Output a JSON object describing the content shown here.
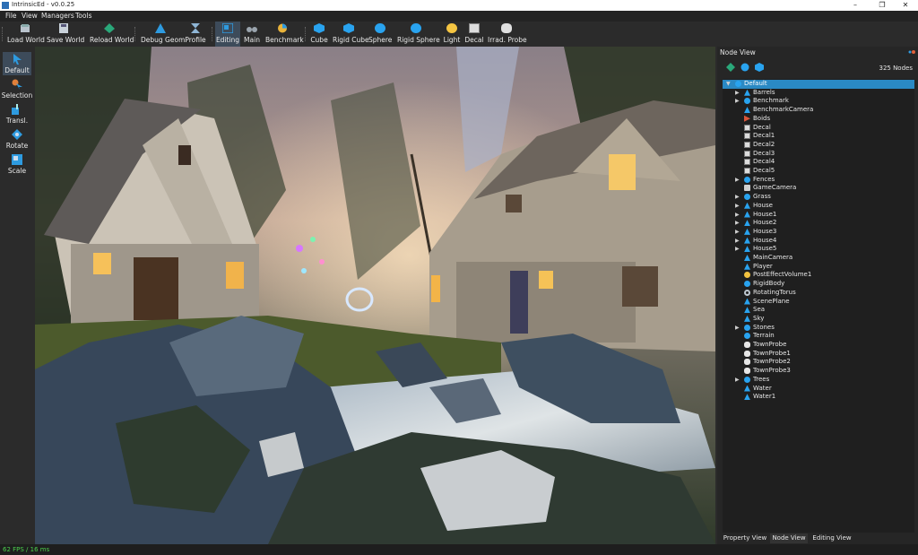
{
  "window": {
    "title": "IntrinsicEd - v0.0.25",
    "minimize": "–",
    "maximize": "❐",
    "close": "✕"
  },
  "menu": [
    "File",
    "View",
    "Managers",
    "Tools"
  ],
  "toolbar": {
    "load_world": "Load World",
    "save_world": "Save World",
    "reload_world": "Reload World",
    "debug_geom": "Debug Geom.",
    "profile": "Profile",
    "editing": "Editing",
    "main": "Main",
    "benchmark": "Benchmark",
    "cube": "Cube",
    "rigid_cube": "Rigid Cube",
    "sphere": "Sphere",
    "rigid_sphere": "Rigid Sphere",
    "light": "Light",
    "decal": "Decal",
    "irrad_probe": "Irrad. Probe"
  },
  "left_tools": {
    "default": "Default",
    "selection": "Selection",
    "translate": "Transl.",
    "rotate": "Rotate",
    "scale": "Scale"
  },
  "panel": {
    "title": "Node View",
    "node_count": "325 Nodes"
  },
  "tree": [
    {
      "label": "Default",
      "icon": "sphere-icon",
      "level": 0,
      "arrow": "▼",
      "selected": true
    },
    {
      "label": "Barrels",
      "icon": "drop-icon",
      "level": 1,
      "arrow": "▶"
    },
    {
      "label": "Benchmark",
      "icon": "sphere-icon",
      "level": 1,
      "arrow": "▶"
    },
    {
      "label": "BenchmarkCamera",
      "icon": "drop-icon",
      "level": 1,
      "arrow": ""
    },
    {
      "label": "Boids",
      "icon": "boids-icon",
      "level": 1,
      "arrow": ""
    },
    {
      "label": "Decal",
      "icon": "image-icon",
      "level": 1,
      "arrow": ""
    },
    {
      "label": "Decal1",
      "icon": "image-icon",
      "level": 1,
      "arrow": ""
    },
    {
      "label": "Decal2",
      "icon": "image-icon",
      "level": 1,
      "arrow": ""
    },
    {
      "label": "Decal3",
      "icon": "image-icon",
      "level": 1,
      "arrow": ""
    },
    {
      "label": "Decal4",
      "icon": "image-icon",
      "level": 1,
      "arrow": ""
    },
    {
      "label": "Decal5",
      "icon": "image-icon",
      "level": 1,
      "arrow": ""
    },
    {
      "label": "Fences",
      "icon": "sphere-icon",
      "level": 1,
      "arrow": "▶"
    },
    {
      "label": "GameCamera",
      "icon": "camera-icon",
      "level": 1,
      "arrow": ""
    },
    {
      "label": "Grass",
      "icon": "sphere-icon",
      "level": 1,
      "arrow": "▶"
    },
    {
      "label": "House",
      "icon": "drop-icon",
      "level": 1,
      "arrow": "▶"
    },
    {
      "label": "House1",
      "icon": "drop-icon",
      "level": 1,
      "arrow": "▶"
    },
    {
      "label": "House2",
      "icon": "drop-icon",
      "level": 1,
      "arrow": "▶"
    },
    {
      "label": "House3",
      "icon": "drop-icon",
      "level": 1,
      "arrow": "▶"
    },
    {
      "label": "House4",
      "icon": "drop-icon",
      "level": 1,
      "arrow": "▶"
    },
    {
      "label": "House5",
      "icon": "drop-icon",
      "level": 1,
      "arrow": "▶"
    },
    {
      "label": "MainCamera",
      "icon": "drop-icon",
      "level": 1,
      "arrow": ""
    },
    {
      "label": "Player",
      "icon": "drop-icon",
      "level": 1,
      "arrow": ""
    },
    {
      "label": "PostEffectVolume1",
      "icon": "sun-icon",
      "level": 1,
      "arrow": ""
    },
    {
      "label": "RigidBody",
      "icon": "sphere-icon",
      "level": 1,
      "arrow": ""
    },
    {
      "label": "RotatingTorus",
      "icon": "torus-icon",
      "level": 1,
      "arrow": ""
    },
    {
      "label": "ScenePlane",
      "icon": "drop-icon",
      "level": 1,
      "arrow": ""
    },
    {
      "label": "Sea",
      "icon": "drop-icon",
      "level": 1,
      "arrow": ""
    },
    {
      "label": "Sky",
      "icon": "drop-icon",
      "level": 1,
      "arrow": ""
    },
    {
      "label": "Stones",
      "icon": "sphere-icon",
      "level": 1,
      "arrow": "▶"
    },
    {
      "label": "Terrain",
      "icon": "sphere-icon",
      "level": 1,
      "arrow": ""
    },
    {
      "label": "TownProbe",
      "icon": "cloud-icon",
      "level": 1,
      "arrow": ""
    },
    {
      "label": "TownProbe1",
      "icon": "cloud-icon",
      "level": 1,
      "arrow": ""
    },
    {
      "label": "TownProbe2",
      "icon": "cloud-icon",
      "level": 1,
      "arrow": ""
    },
    {
      "label": "TownProbe3",
      "icon": "cloud-icon",
      "level": 1,
      "arrow": ""
    },
    {
      "label": "Trees",
      "icon": "sphere-icon",
      "level": 1,
      "arrow": "▶"
    },
    {
      "label": "Water",
      "icon": "drop-icon",
      "level": 1,
      "arrow": ""
    },
    {
      "label": "Water1",
      "icon": "drop-icon",
      "level": 1,
      "arrow": ""
    }
  ],
  "tabs": [
    "Property View",
    "Node View",
    "Editing View"
  ],
  "active_tab": "Node View",
  "status": "62 FPS / 16 ms",
  "colors": {
    "accent": "#2a89c4",
    "icon_blue": "#29a3ef",
    "fps_green": "#4cd04c"
  }
}
